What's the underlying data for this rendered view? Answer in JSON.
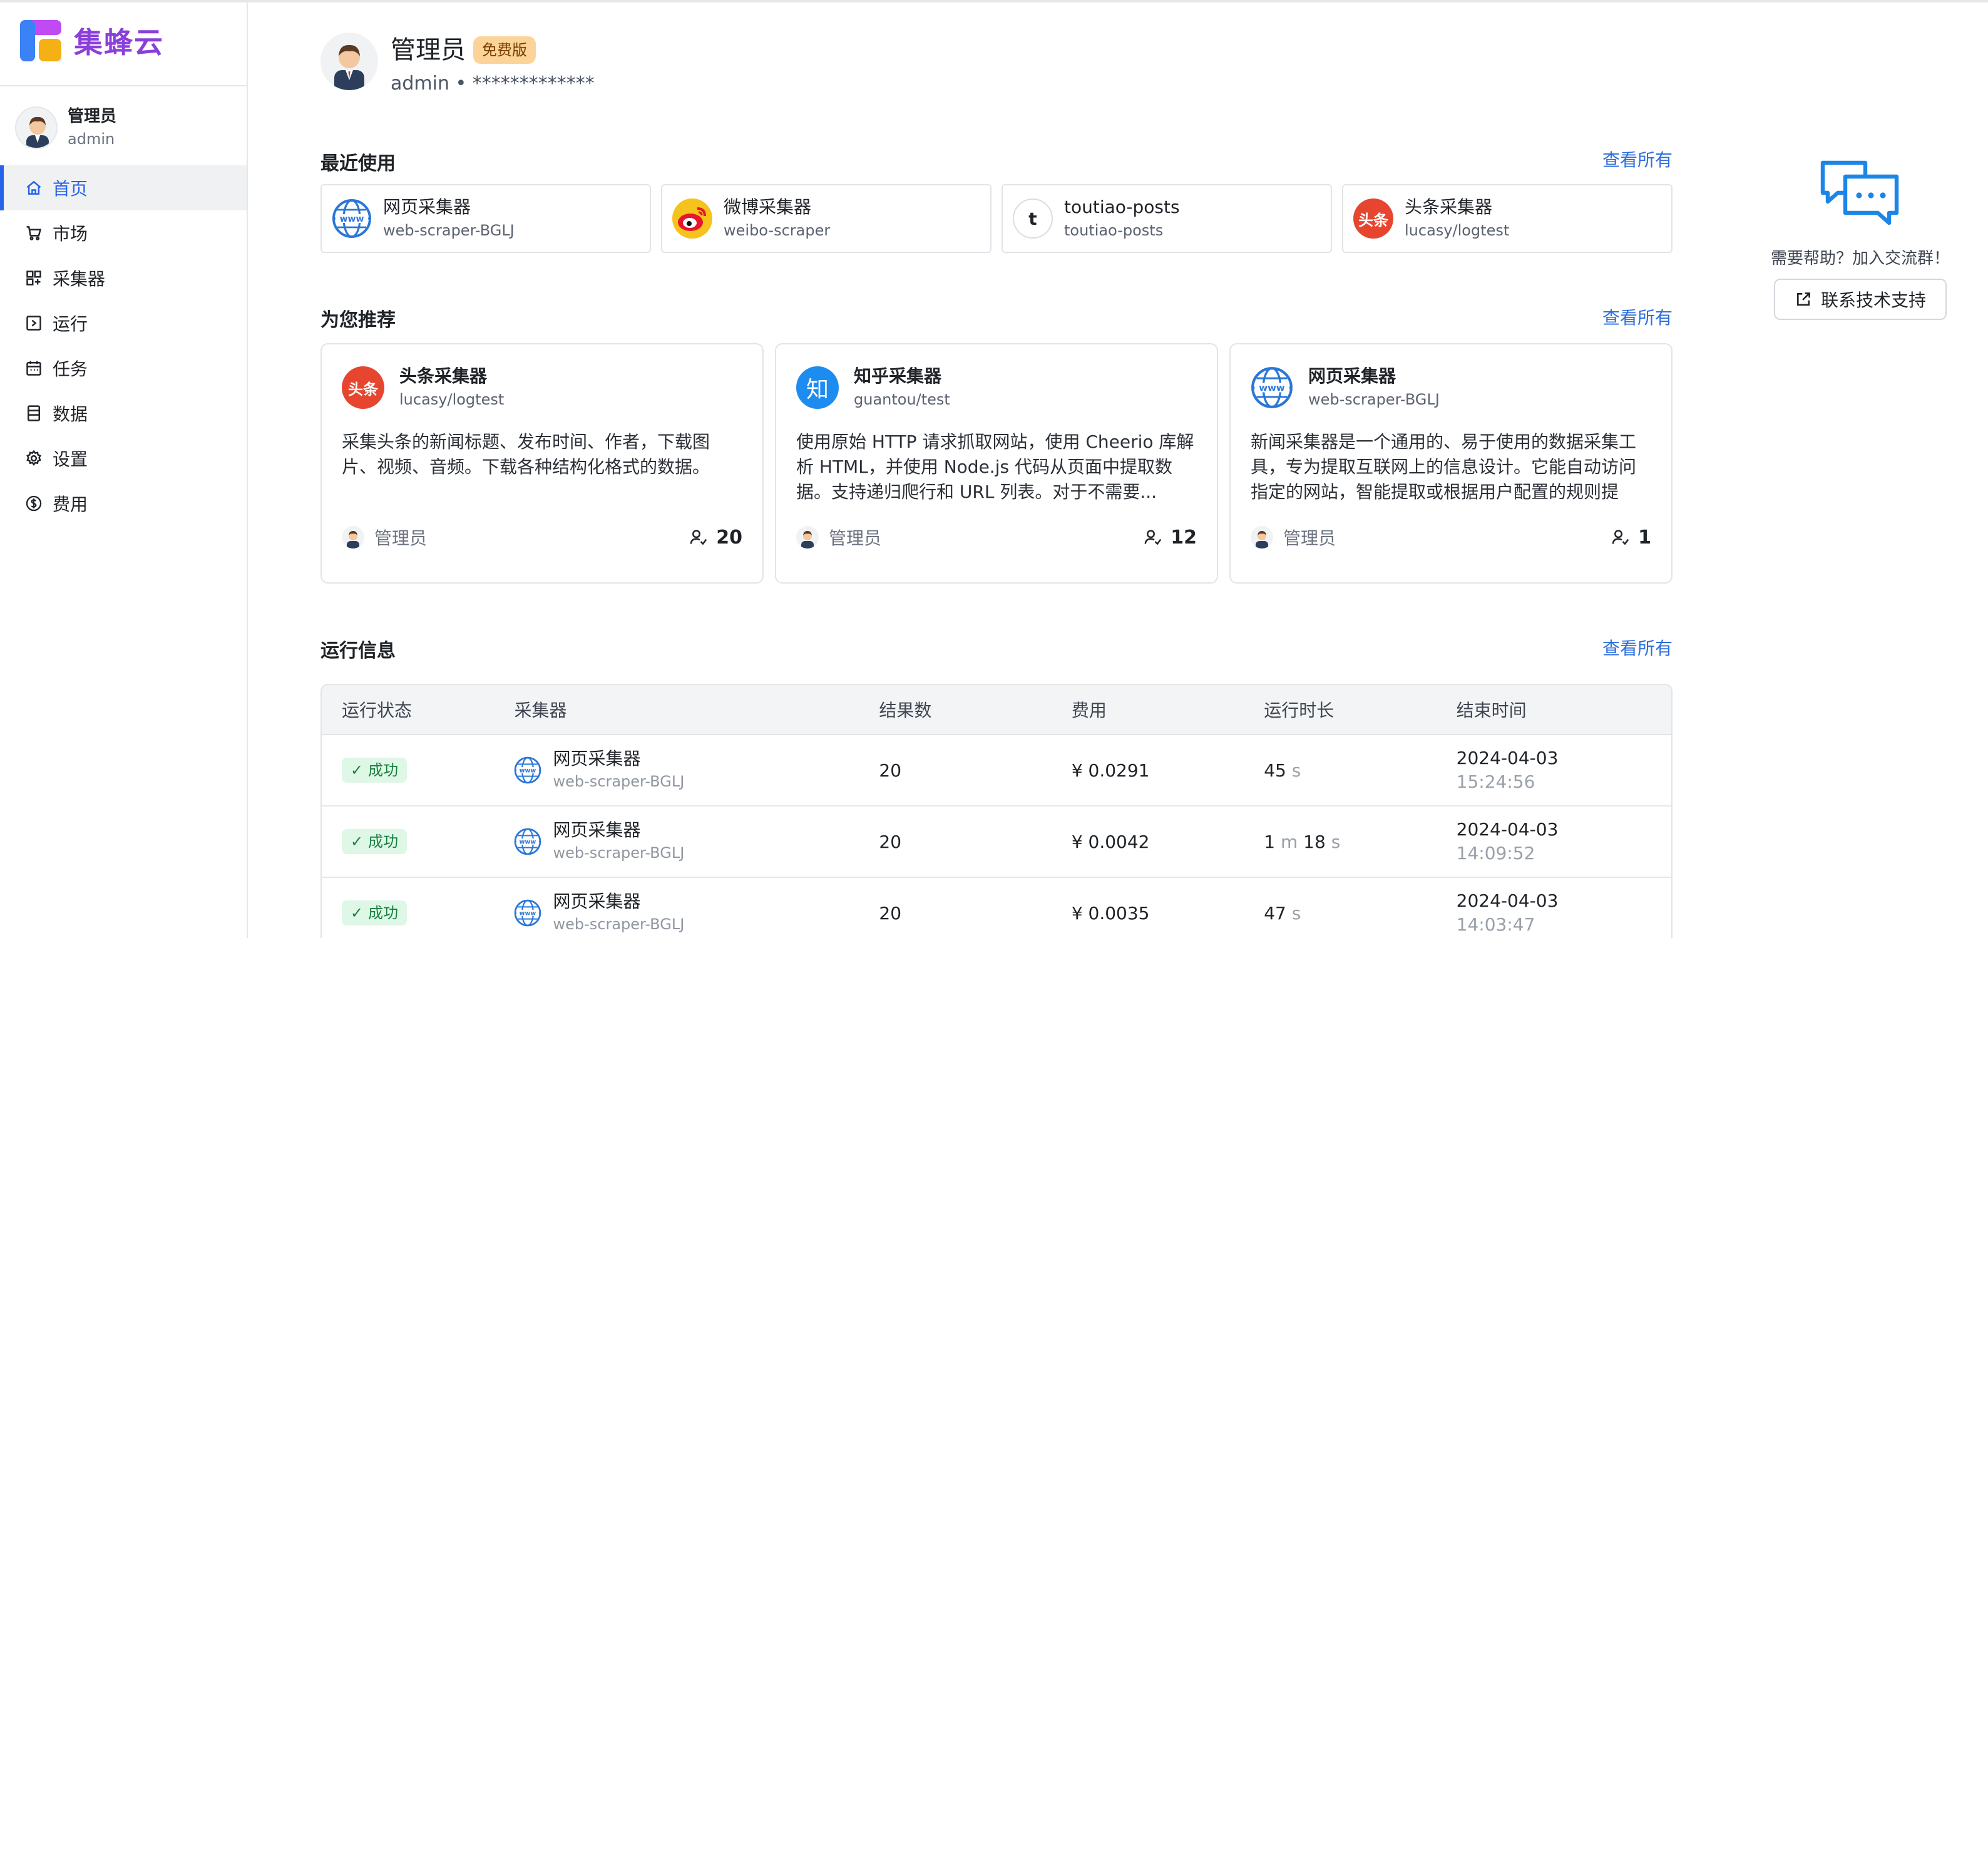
{
  "app": {
    "name": "集蜂云"
  },
  "user": {
    "display_name": "管理员",
    "username": "admin",
    "plan_badge": "免费版",
    "masked_token": "admin • *************"
  },
  "nav": [
    {
      "label": "首页",
      "icon": "home-icon",
      "active": true
    },
    {
      "label": "市场",
      "icon": "cart-icon"
    },
    {
      "label": "采集器",
      "icon": "grid-icon"
    },
    {
      "label": "运行",
      "icon": "run-icon"
    },
    {
      "label": "任务",
      "icon": "calendar-icon"
    },
    {
      "label": "数据",
      "icon": "database-icon"
    },
    {
      "label": "设置",
      "icon": "gear-icon"
    },
    {
      "label": "费用",
      "icon": "dollar-icon"
    }
  ],
  "recent": {
    "title": "最近使用",
    "see_all": "查看所有",
    "items": [
      {
        "name": "网页采集器",
        "id": "web-scraper-BGLJ",
        "icon": "globe-icon"
      },
      {
        "name": "微博采集器",
        "id": "weibo-scraper",
        "icon": "weibo-icon"
      },
      {
        "name": "toutiao-posts",
        "id": "toutiao-posts",
        "icon": "letter-t-icon",
        "letter": "t"
      },
      {
        "name": "头条采集器",
        "id": "lucasy/logtest",
        "icon": "toutiao-icon",
        "logo_text": "头条"
      }
    ]
  },
  "recommend": {
    "title": "为您推荐",
    "see_all": "查看所有",
    "items": [
      {
        "name": "头条采集器",
        "id": "lucasy/logtest",
        "icon": "toutiao-icon",
        "logo_text": "头条",
        "desc": "采集头条的新闻标题、发布时间、作者，下载图片、视频、音频。下载各种结构化格式的数据。",
        "author": "管理员",
        "users": "20"
      },
      {
        "name": "知乎采集器",
        "id": "guantou/test",
        "icon": "zhihu-icon",
        "logo_text": "知",
        "desc": "使用原始 HTTP 请求抓取网站，使用 Cheerio 库解析 HTML，并使用 Node.js 代码从页面中提取数据。支持递归爬行和 URL 列表。对于不需要...",
        "author": "管理员",
        "users": "12"
      },
      {
        "name": "网页采集器",
        "id": "web-scraper-BGLJ",
        "icon": "globe-icon",
        "desc": "新闻采集器是一个通用的、易于使用的数据采集工具，专为提取互联网上的信息设计。它能自动访问指定的网站，智能提取或根据用户配置的规则提取...",
        "author": "管理员",
        "users": "1"
      }
    ]
  },
  "runs": {
    "title": "运行信息",
    "see_all": "查看所有",
    "columns": [
      "运行状态",
      "采集器",
      "结果数",
      "费用",
      "运行时长",
      "结束时间"
    ],
    "rows": [
      {
        "status": "成功",
        "name": "网页采集器",
        "id": "web-scraper-BGLJ",
        "results": "20",
        "cost": "¥ 0.0291",
        "dur": [
          {
            "v": "45",
            "u": "s"
          }
        ],
        "date": "2024-04-03",
        "time": "15:24:56"
      },
      {
        "status": "成功",
        "name": "网页采集器",
        "id": "web-scraper-BGLJ",
        "results": "20",
        "cost": "¥ 0.0042",
        "dur": [
          {
            "v": "1",
            "u": "m"
          },
          {
            "v": "18",
            "u": "s"
          }
        ],
        "date": "2024-04-03",
        "time": "14:09:52"
      },
      {
        "status": "成功",
        "name": "网页采集器",
        "id": "web-scraper-BGLJ",
        "results": "20",
        "cost": "¥ 0.0035",
        "dur": [
          {
            "v": "47",
            "u": "s"
          }
        ],
        "date": "2024-04-03",
        "time": "14:03:47"
      }
    ]
  },
  "help": {
    "text": "需要帮助？加入交流群！",
    "button": "联系技术支持"
  },
  "colors": {
    "accent": "#2f6fdb",
    "brand": "#8b3fd9",
    "badge": "#fcd49a",
    "success_bg": "#dff7e6"
  }
}
